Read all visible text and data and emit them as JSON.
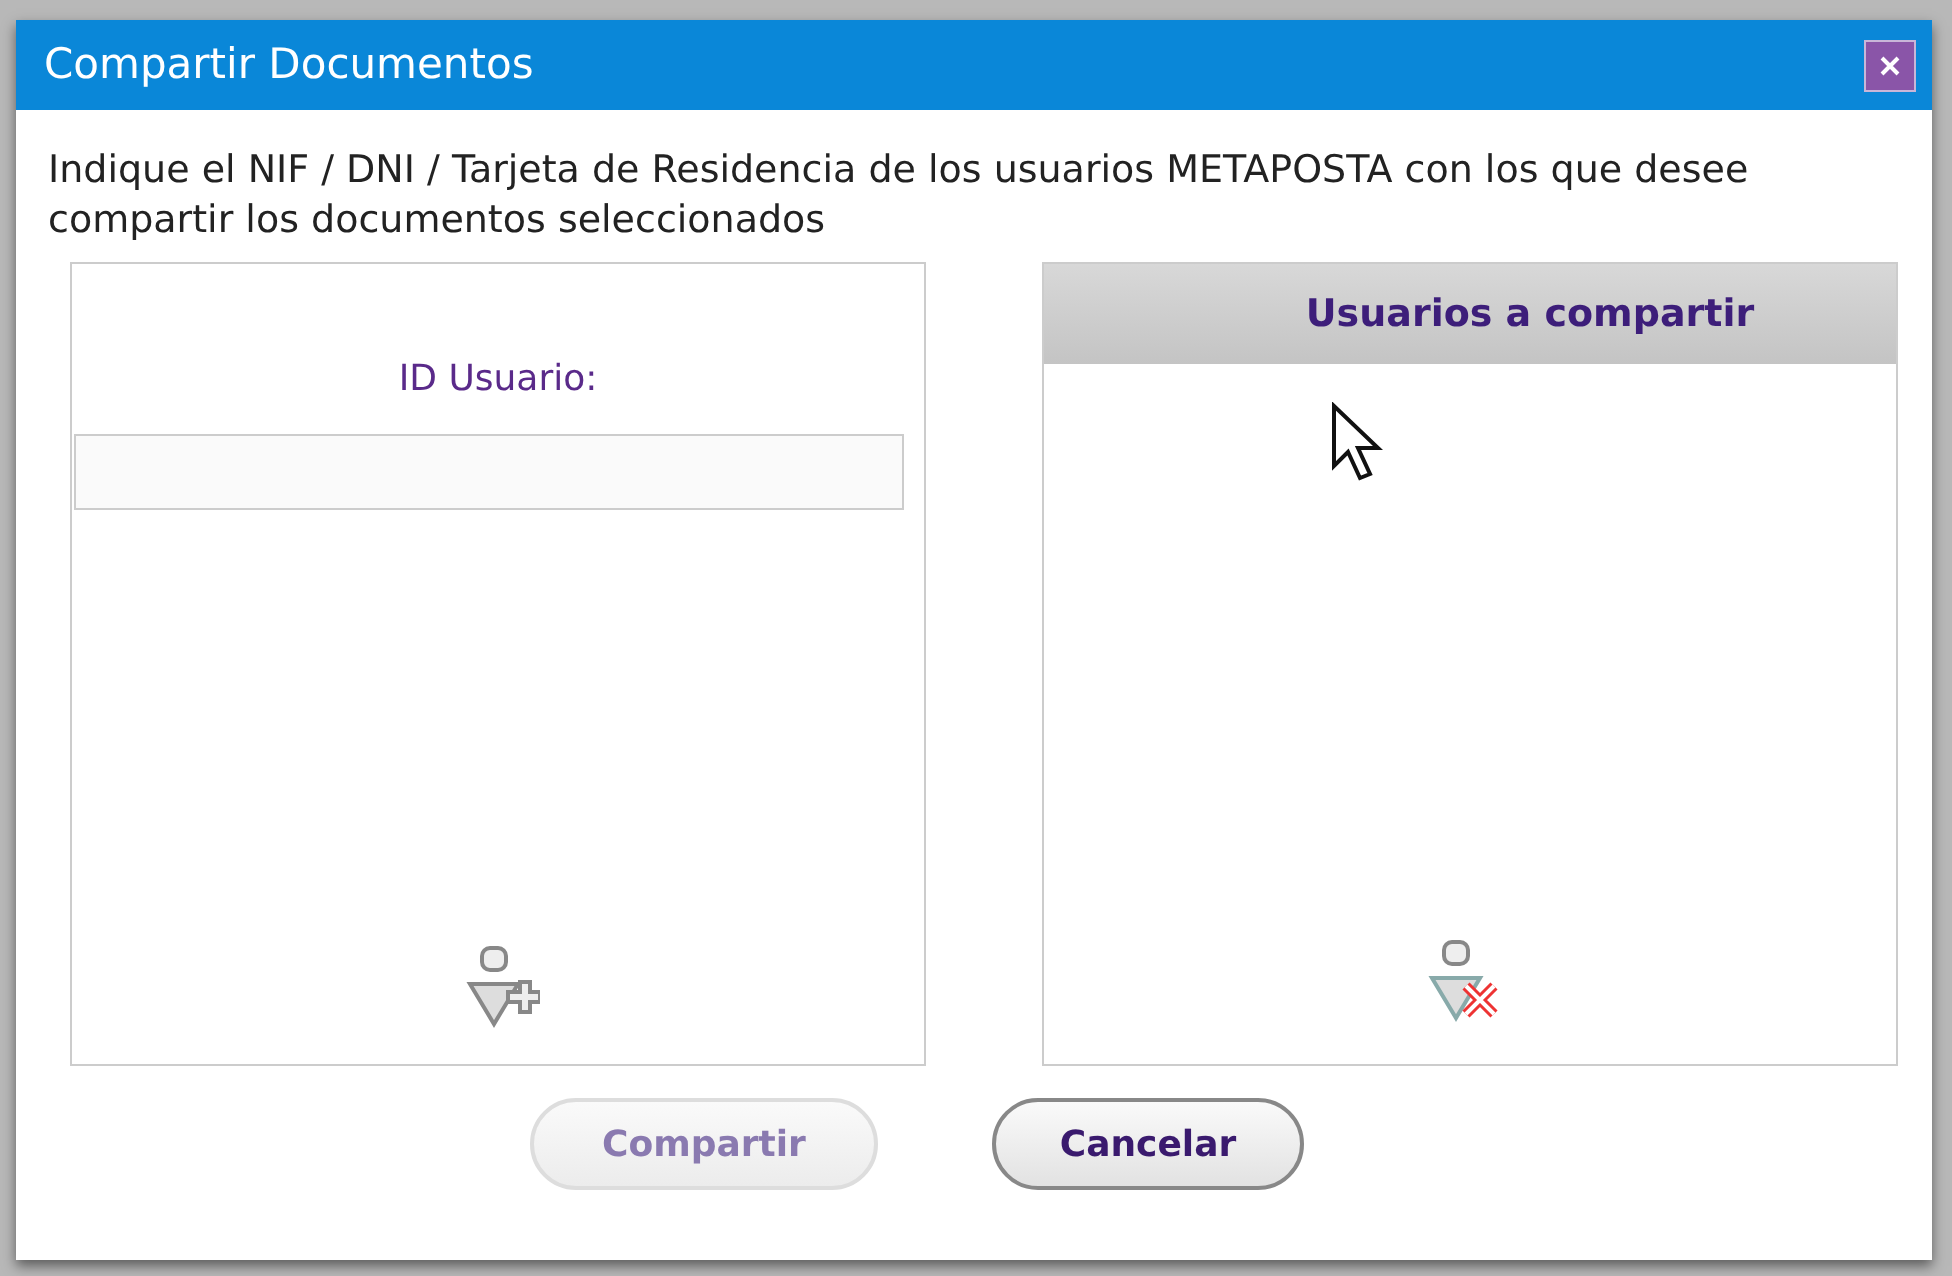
{
  "window": {
    "title": "Compartir Documentos"
  },
  "instructions": "Indique el NIF / DNI / Tarjeta de Residencia de los usuarios METAPOSTA con los que desee compartir los documentos seleccionados",
  "id_panel": {
    "label": "ID Usuario:"
  },
  "users_panel": {
    "header": "Usuarios a compartir"
  },
  "buttons": [
    {
      "label": "Compartir",
      "disabled": true
    },
    {
      "label": "Cancelar",
      "disabled": false
    }
  ]
}
